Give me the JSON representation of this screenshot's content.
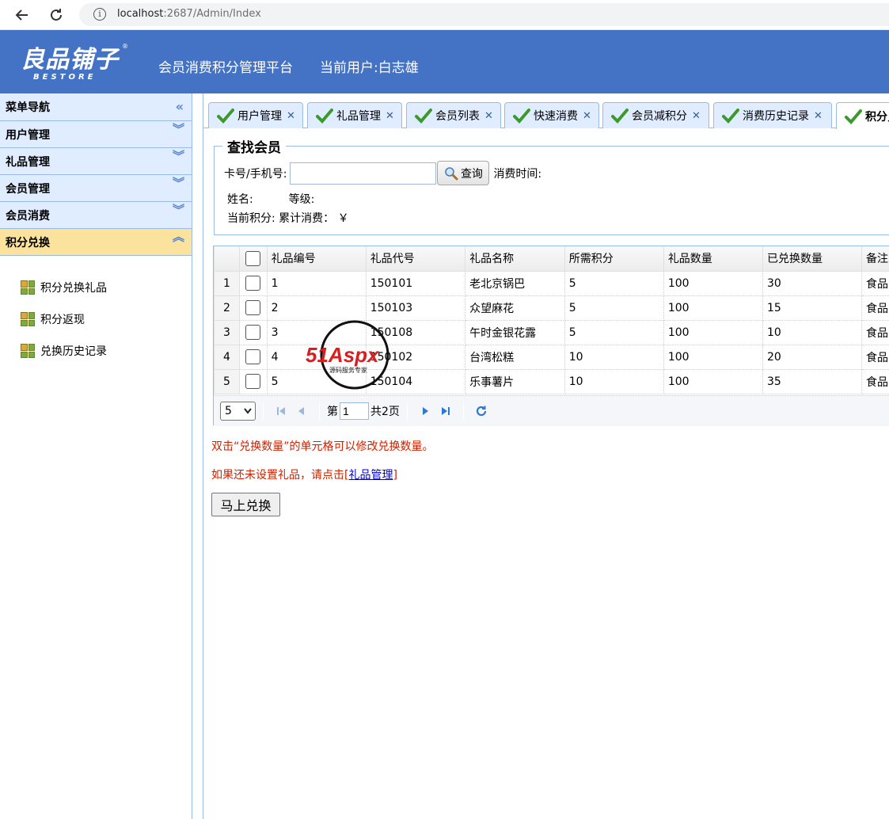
{
  "browser": {
    "url_host": "localhost",
    "url_rest": ":2687/Admin/Index"
  },
  "header": {
    "logo_main": "良品铺子",
    "logo_sub": "BESTORE",
    "logo_reg": "®",
    "title": "会员消费积分管理平台",
    "user": "当前用户:白志雄",
    "bg_color": "#4472c4"
  },
  "sidebar": {
    "heading": "菜单导航",
    "groups": [
      {
        "label": "用户管理"
      },
      {
        "label": "礼品管理"
      },
      {
        "label": "会员管理"
      },
      {
        "label": "会员消费"
      },
      {
        "label": "积分兑换"
      }
    ],
    "items": [
      {
        "label": "积分兑换礼品"
      },
      {
        "label": "积分返现"
      },
      {
        "label": "兑换历史记录"
      }
    ]
  },
  "tabs": [
    {
      "label": "用户管理"
    },
    {
      "label": "礼品管理"
    },
    {
      "label": "会员列表"
    },
    {
      "label": "快速消费"
    },
    {
      "label": "会员减积分"
    },
    {
      "label": "消费历史记录"
    },
    {
      "label": "积分兑"
    }
  ],
  "search": {
    "legend": "查找会员",
    "card_label": "卡号/手机号:",
    "card_value": "",
    "button_label": "查询",
    "time_label": "消费时间:",
    "name_label": "姓名:",
    "level_label": "等级:",
    "points_label": "当前积分:",
    "total_label": "累计消费：",
    "currency": "￥"
  },
  "grid": {
    "columns": [
      "礼品编号",
      "礼品代号",
      "礼品名称",
      "所需积分",
      "礼品数量",
      "已兑换数量",
      "备注"
    ],
    "rows": [
      {
        "num": "1",
        "id": "1",
        "code": "150101",
        "name": "老北京锅巴",
        "points": "5",
        "qty": "100",
        "redeemed": "30",
        "note": "食品"
      },
      {
        "num": "2",
        "id": "2",
        "code": "150103",
        "name": "众望麻花",
        "points": "5",
        "qty": "100",
        "redeemed": "15",
        "note": "食品"
      },
      {
        "num": "3",
        "id": "3",
        "code": "150108",
        "name": "午时金银花露",
        "points": "5",
        "qty": "100",
        "redeemed": "10",
        "note": "食品"
      },
      {
        "num": "4",
        "id": "4",
        "code": "150102",
        "name": "台湾松糕",
        "points": "10",
        "qty": "100",
        "redeemed": "20",
        "note": "食品"
      },
      {
        "num": "5",
        "id": "5",
        "code": "150104",
        "name": "乐事薯片",
        "points": "10",
        "qty": "100",
        "redeemed": "35",
        "note": "食品"
      }
    ]
  },
  "pager": {
    "page_size": "5",
    "page_prefix": "第",
    "page_value": "1",
    "page_total": "共2页"
  },
  "hints": {
    "hint1": "双击“兑换数量”的单元格可以修改兑换数量。",
    "hint2_prefix": "如果还未设置礼品，请点击[",
    "hint2_link": "礼品管理",
    "hint2_suffix": "]"
  },
  "redeem_button": "马上兑换",
  "watermark": {
    "brand": "51Aspx",
    "tagline": "源码服务专家"
  }
}
